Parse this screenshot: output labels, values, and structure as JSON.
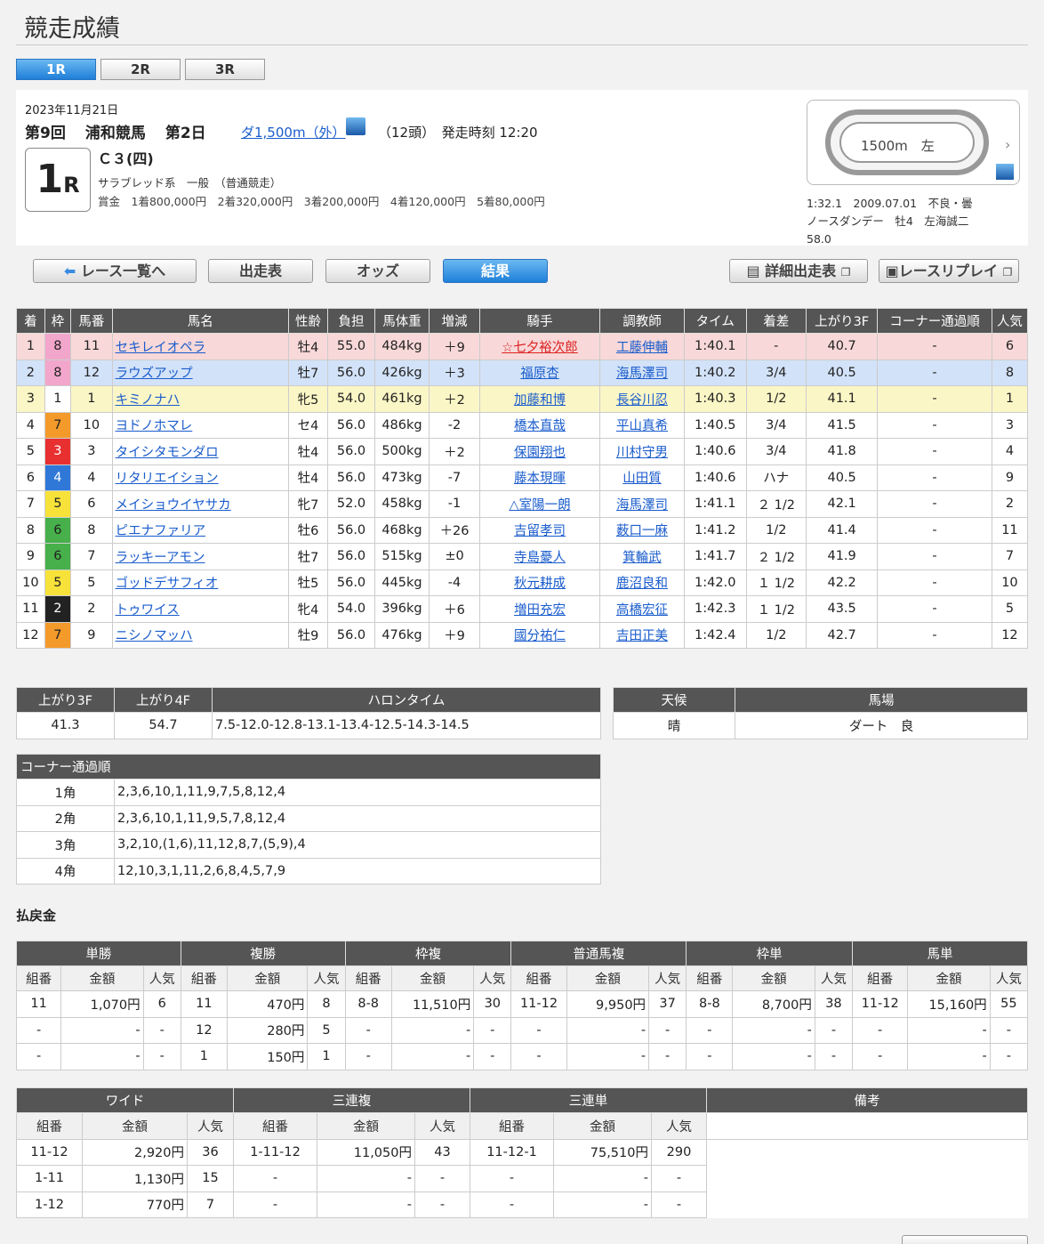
{
  "page_title": "競走成績",
  "race_tabs": [
    "1R",
    "2R",
    "3R"
  ],
  "race": {
    "date": "2023年11月21日",
    "kai": "第9回",
    "place": "浦和競馬",
    "day": "第2日",
    "distance": "ダ1,500m（外）",
    "heads": "（12頭）",
    "start": "発走時刻 12:20",
    "rnum": "1",
    "rsuffix": "R",
    "class": "Ｃ３(四)",
    "breed": "サラブレッド系　一般　（普通競走）",
    "prize": "賞金　1着800,000円　2着320,000円　3着200,000円　4着120,000円　5着80,000円"
  },
  "track": {
    "length": "1500m　左",
    "record1": "1:32.1　2009.07.01　不良・曇",
    "record2": "ノースダンデー　牡4　左海誠二",
    "record3": "58.0"
  },
  "nav": {
    "list": "レース一覧へ",
    "entries": "出走表",
    "odds": "オッズ",
    "results": "結果",
    "detail": "詳細出走表",
    "replay": "レースリプレイ"
  },
  "result_headers": [
    "着",
    "枠",
    "馬番",
    "馬名",
    "性齢",
    "負担",
    "馬体重",
    "増減",
    "騎手",
    "調教師",
    "タイム",
    "着差",
    "上がり3F",
    "コーナー通過順",
    "人気"
  ],
  "results": [
    [
      "1",
      "8",
      "11",
      "セキレイオペラ",
      "牡4",
      "55.0",
      "484kg",
      "＋9",
      "☆七夕裕次郎",
      "工藤伸輔",
      "1:40.1",
      "-",
      "40.7",
      "-",
      "6"
    ],
    [
      "2",
      "8",
      "12",
      "ラウズアップ",
      "牡7",
      "56.0",
      "426kg",
      "＋3",
      "福原杏",
      "海馬澤司",
      "1:40.2",
      "3/4",
      "40.5",
      "-",
      "8"
    ],
    [
      "3",
      "1",
      "1",
      "キミノナハ",
      "牝5",
      "54.0",
      "461kg",
      "＋2",
      "加藤和博",
      "長谷川忍",
      "1:40.3",
      "1/2",
      "41.1",
      "-",
      "1"
    ],
    [
      "4",
      "7",
      "10",
      "ヨドノホマレ",
      "セ4",
      "56.0",
      "486kg",
      "-2",
      "橋本直哉",
      "平山真希",
      "1:40.5",
      "3/4",
      "41.5",
      "-",
      "3"
    ],
    [
      "5",
      "3",
      "3",
      "タイシタモンダロ",
      "牡4",
      "56.0",
      "500kg",
      "＋2",
      "保園翔也",
      "川村守男",
      "1:40.6",
      "3/4",
      "41.8",
      "-",
      "4"
    ],
    [
      "6",
      "4",
      "4",
      "リタリエイション",
      "牡4",
      "56.0",
      "473kg",
      "-7",
      "藤本現暉",
      "山田質",
      "1:40.6",
      "ハナ",
      "40.5",
      "-",
      "9"
    ],
    [
      "7",
      "5",
      "6",
      "メイショウイヤサカ",
      "牝7",
      "52.0",
      "458kg",
      "-1",
      "△室陽一朗",
      "海馬澤司",
      "1:41.1",
      "２ 1/2",
      "42.1",
      "-",
      "2"
    ],
    [
      "8",
      "6",
      "8",
      "ピエナファリア",
      "牡6",
      "56.0",
      "468kg",
      "＋26",
      "吉留孝司",
      "薮口一麻",
      "1:41.2",
      "1/2",
      "41.4",
      "-",
      "11"
    ],
    [
      "9",
      "6",
      "7",
      "ラッキーアモン",
      "牡7",
      "56.0",
      "515kg",
      "±0",
      "寺島憂人",
      "箕輪武",
      "1:41.7",
      "２ 1/2",
      "41.9",
      "-",
      "7"
    ],
    [
      "10",
      "5",
      "5",
      "ゴッドデサフィオ",
      "牡5",
      "56.0",
      "445kg",
      "-4",
      "秋元耕成",
      "鹿沼良和",
      "1:42.0",
      "１ 1/2",
      "42.2",
      "-",
      "10"
    ],
    [
      "11",
      "2",
      "2",
      "トゥワイス",
      "牝4",
      "54.0",
      "396kg",
      "＋6",
      "増田充宏",
      "高橋宏征",
      "1:42.3",
      "１ 1/2",
      "43.5",
      "-",
      "5"
    ],
    [
      "12",
      "7",
      "9",
      "ニシノマッハ",
      "牡9",
      "56.0",
      "476kg",
      "＋9",
      "國分祐仁",
      "吉田正美",
      "1:42.4",
      "1/2",
      "42.7",
      "-",
      "12"
    ]
  ],
  "laps": {
    "h3f": "上がり3F",
    "h4f": "上がり4F",
    "hhalon": "ハロンタイム",
    "v3f": "41.3",
    "v4f": "54.7",
    "halon": "7.5-12.0-12.8-13.1-13.4-12.5-14.3-14.5"
  },
  "weather": {
    "h_weather": "天候",
    "h_track": "馬場",
    "weather": "晴",
    "track": "ダート　良"
  },
  "corner": {
    "title": "コーナー通過順",
    "rows": [
      [
        "1角",
        "2,3,6,10,1,11,9,7,5,8,12,4"
      ],
      [
        "2角",
        "2,3,6,10,1,11,9,5,7,8,12,4"
      ],
      [
        "3角",
        "3,2,10,(1,6),11,12,8,7,(5,9),4"
      ],
      [
        "4角",
        "12,10,3,1,11,2,6,8,4,5,7,9"
      ]
    ]
  },
  "payout_title": "払戻金",
  "pay1": {
    "groups": [
      "単勝",
      "複勝",
      "枠複",
      "普通馬複",
      "枠単",
      "馬単"
    ],
    "sub": [
      "組番",
      "金額",
      "人気"
    ],
    "rows": [
      [
        "11",
        "1,070円",
        "6",
        "11",
        "470円",
        "8",
        "8-8",
        "11,510円",
        "30",
        "11-12",
        "9,950円",
        "37",
        "8-8",
        "8,700円",
        "38",
        "11-12",
        "15,160円",
        "55"
      ],
      [
        "-",
        "-",
        "-",
        "12",
        "280円",
        "5",
        "-",
        "-",
        "-",
        "-",
        "-",
        "-",
        "-",
        "-",
        "-",
        "-",
        "-",
        "-"
      ],
      [
        "-",
        "-",
        "-",
        "1",
        "150円",
        "1",
        "-",
        "-",
        "-",
        "-",
        "-",
        "-",
        "-",
        "-",
        "-",
        "-",
        "-",
        "-"
      ]
    ]
  },
  "pay2": {
    "groups": [
      "ワイド",
      "三連複",
      "三連単",
      "備考"
    ],
    "rows": [
      [
        "11-12",
        "2,920円",
        "36",
        "1-11-12",
        "11,050円",
        "43",
        "11-12-1",
        "75,510円",
        "290"
      ],
      [
        "1-11",
        "1,130円",
        "15",
        "-",
        "-",
        "-",
        "-",
        "-",
        "-"
      ],
      [
        "1-12",
        "770円",
        "7",
        "-",
        "-",
        "-",
        "-",
        "-",
        "-"
      ]
    ]
  }
}
